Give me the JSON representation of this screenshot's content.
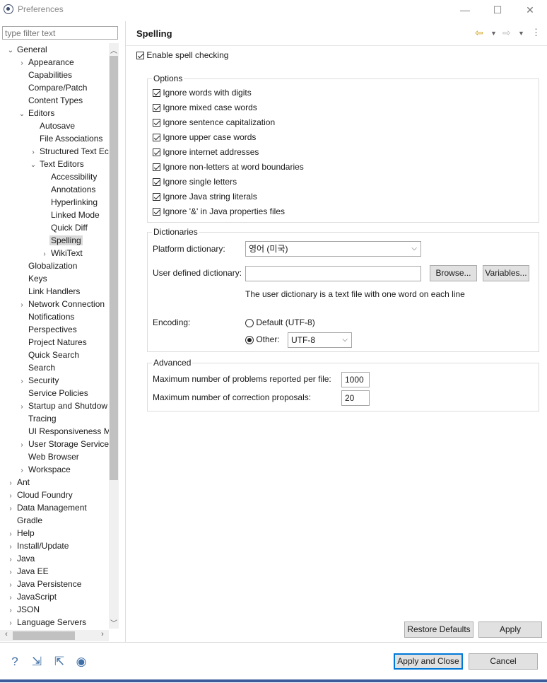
{
  "window": {
    "title": "Preferences",
    "minimize": "—",
    "maximize": "☐",
    "close": "✕"
  },
  "filter": {
    "placeholder": "type filter text"
  },
  "tree": [
    {
      "label": "General",
      "level": 0,
      "tw": "v"
    },
    {
      "label": "Appearance",
      "level": 1,
      "tw": ">"
    },
    {
      "label": "Capabilities",
      "level": 1,
      "tw": ""
    },
    {
      "label": "Compare/Patch",
      "level": 1,
      "tw": ""
    },
    {
      "label": "Content Types",
      "level": 1,
      "tw": ""
    },
    {
      "label": "Editors",
      "level": 1,
      "tw": "v"
    },
    {
      "label": "Autosave",
      "level": 2,
      "tw": ""
    },
    {
      "label": "File Associations",
      "level": 2,
      "tw": ""
    },
    {
      "label": "Structured Text Ec",
      "level": 2,
      "tw": ">"
    },
    {
      "label": "Text Editors",
      "level": 2,
      "tw": "v"
    },
    {
      "label": "Accessibility",
      "level": 3,
      "tw": ""
    },
    {
      "label": "Annotations",
      "level": 3,
      "tw": ""
    },
    {
      "label": "Hyperlinking",
      "level": 3,
      "tw": ""
    },
    {
      "label": "Linked Mode",
      "level": 3,
      "tw": ""
    },
    {
      "label": "Quick Diff",
      "level": 3,
      "tw": ""
    },
    {
      "label": "Spelling",
      "level": 3,
      "tw": "",
      "selected": true
    },
    {
      "label": "WikiText",
      "level": 3,
      "tw": ">"
    },
    {
      "label": "Globalization",
      "level": 1,
      "tw": ""
    },
    {
      "label": "Keys",
      "level": 1,
      "tw": ""
    },
    {
      "label": "Link Handlers",
      "level": 1,
      "tw": ""
    },
    {
      "label": "Network Connection",
      "level": 1,
      "tw": ">"
    },
    {
      "label": "Notifications",
      "level": 1,
      "tw": ""
    },
    {
      "label": "Perspectives",
      "level": 1,
      "tw": ""
    },
    {
      "label": "Project Natures",
      "level": 1,
      "tw": ""
    },
    {
      "label": "Quick Search",
      "level": 1,
      "tw": ""
    },
    {
      "label": "Search",
      "level": 1,
      "tw": ""
    },
    {
      "label": "Security",
      "level": 1,
      "tw": ">"
    },
    {
      "label": "Service Policies",
      "level": 1,
      "tw": ""
    },
    {
      "label": "Startup and Shutdow",
      "level": 1,
      "tw": ">"
    },
    {
      "label": "Tracing",
      "level": 1,
      "tw": ""
    },
    {
      "label": "UI Responsiveness M",
      "level": 1,
      "tw": ""
    },
    {
      "label": "User Storage Service",
      "level": 1,
      "tw": ">"
    },
    {
      "label": "Web Browser",
      "level": 1,
      "tw": ""
    },
    {
      "label": "Workspace",
      "level": 1,
      "tw": ">"
    },
    {
      "label": "Ant",
      "level": 0,
      "tw": ">"
    },
    {
      "label": "Cloud Foundry",
      "level": 0,
      "tw": ">"
    },
    {
      "label": "Data Management",
      "level": 0,
      "tw": ">"
    },
    {
      "label": "Gradle",
      "level": 0,
      "tw": ""
    },
    {
      "label": "Help",
      "level": 0,
      "tw": ">"
    },
    {
      "label": "Install/Update",
      "level": 0,
      "tw": ">"
    },
    {
      "label": "Java",
      "level": 0,
      "tw": ">"
    },
    {
      "label": "Java EE",
      "level": 0,
      "tw": ">"
    },
    {
      "label": "Java Persistence",
      "level": 0,
      "tw": ">"
    },
    {
      "label": "JavaScript",
      "level": 0,
      "tw": ">"
    },
    {
      "label": "JSON",
      "level": 0,
      "tw": ">"
    },
    {
      "label": "Language Servers",
      "level": 0,
      "tw": ">"
    }
  ],
  "page": {
    "title": "Spelling",
    "enable_spell": {
      "label": "Enable spell checking",
      "checked": true
    },
    "options": {
      "title": "Options",
      "items": [
        {
          "label": "Ignore words with digits",
          "checked": true
        },
        {
          "label": "Ignore mixed case words",
          "checked": true
        },
        {
          "label": "Ignore sentence capitalization",
          "checked": true
        },
        {
          "label": "Ignore upper case words",
          "checked": true
        },
        {
          "label": "Ignore internet addresses",
          "checked": true
        },
        {
          "label": "Ignore non-letters at word boundaries",
          "checked": true
        },
        {
          "label": "Ignore single letters",
          "checked": true
        },
        {
          "label": "Ignore Java string literals",
          "checked": true
        },
        {
          "label": "Ignore '&' in Java properties files",
          "checked": true
        }
      ]
    },
    "dictionaries": {
      "title": "Dictionaries",
      "platform_label": "Platform dictionary:",
      "platform_value": "영어 (미국)",
      "user_label": "User defined dictionary:",
      "user_value": "",
      "browse": "Browse...",
      "variables": "Variables...",
      "hint": "The user dictionary is a text file with one word on each line",
      "encoding_label": "Encoding:",
      "default_label": "Default (UTF-8)",
      "other_label": "Other:",
      "other_value": "UTF-8",
      "selected_encoding": "other"
    },
    "advanced": {
      "title": "Advanced",
      "max_problems_label": "Maximum number of problems reported per file:",
      "max_problems_value": "1000",
      "max_proposals_label": "Maximum number of correction proposals:",
      "max_proposals_value": "20"
    },
    "restore_defaults": "Restore Defaults",
    "apply": "Apply"
  },
  "footer": {
    "apply_close": "Apply and Close",
    "cancel": "Cancel"
  }
}
